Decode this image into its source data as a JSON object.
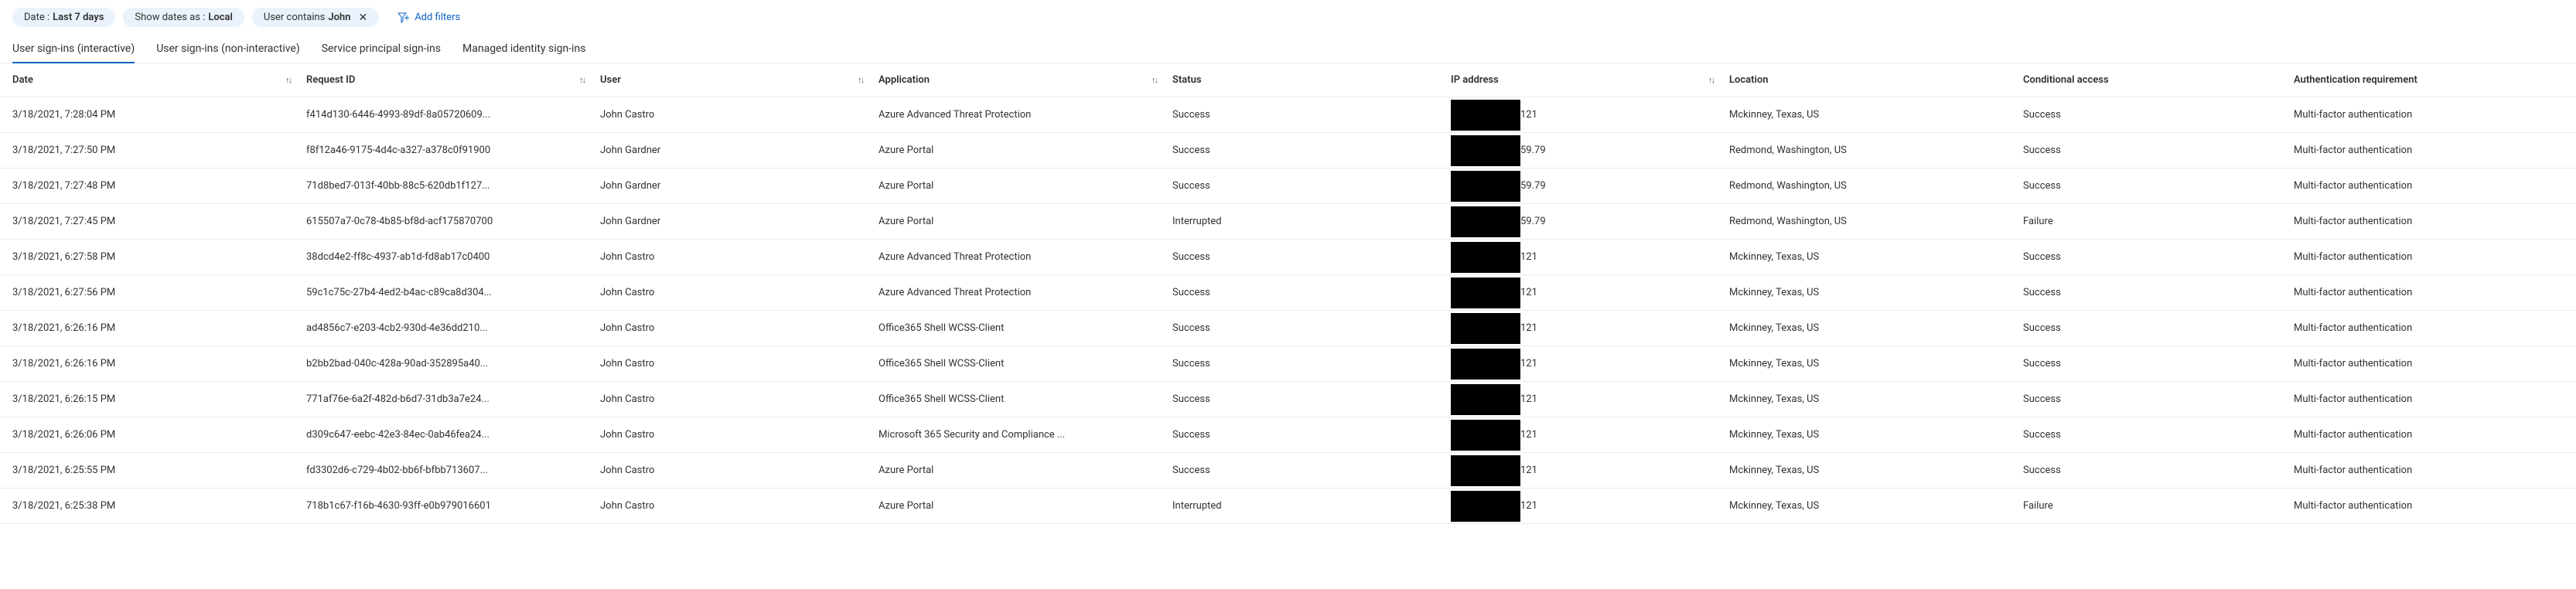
{
  "filters": {
    "date": {
      "label": "Date :",
      "value": "Last 7 days"
    },
    "showDates": {
      "label": "Show dates as :",
      "value": "Local"
    },
    "user": {
      "label": "User contains",
      "value": "John"
    },
    "addFilters": "Add filters"
  },
  "tabs": [
    {
      "label": "User sign-ins (interactive)",
      "active": true
    },
    {
      "label": "User sign-ins (non-interactive)",
      "active": false
    },
    {
      "label": "Service principal sign-ins",
      "active": false
    },
    {
      "label": "Managed identity sign-ins",
      "active": false
    }
  ],
  "columns": [
    {
      "label": "Date",
      "sortable": true
    },
    {
      "label": "Request ID",
      "sortable": true
    },
    {
      "label": "User",
      "sortable": true
    },
    {
      "label": "Application",
      "sortable": true
    },
    {
      "label": "Status",
      "sortable": false
    },
    {
      "label": "IP address",
      "sortable": true
    },
    {
      "label": "Location",
      "sortable": false
    },
    {
      "label": "Conditional access",
      "sortable": false
    },
    {
      "label": "Authentication requirement",
      "sortable": false
    }
  ],
  "rows": [
    {
      "date": "3/18/2021, 7:28:04 PM",
      "requestId": "f414d130-6446-4993-89df-8a05720609...",
      "user": "John Castro",
      "app": "Azure Advanced Threat Protection",
      "status": "Success",
      "ipSuffix": "121",
      "location": "Mckinney, Texas, US",
      "ca": "Success",
      "auth": "Multi-factor authentication"
    },
    {
      "date": "3/18/2021, 7:27:50 PM",
      "requestId": "f8f12a46-9175-4d4c-a327-a378c0f91900",
      "user": "John Gardner",
      "app": "Azure Portal",
      "status": "Success",
      "ipSuffix": "59.79",
      "location": "Redmond, Washington, US",
      "ca": "Success",
      "auth": "Multi-factor authentication"
    },
    {
      "date": "3/18/2021, 7:27:48 PM",
      "requestId": "71d8bed7-013f-40bb-88c5-620db1f127...",
      "user": "John Gardner",
      "app": "Azure Portal",
      "status": "Success",
      "ipSuffix": "59.79",
      "location": "Redmond, Washington, US",
      "ca": "Success",
      "auth": "Multi-factor authentication"
    },
    {
      "date": "3/18/2021, 7:27:45 PM",
      "requestId": "615507a7-0c78-4b85-bf8d-acf175870700",
      "user": "John Gardner",
      "app": "Azure Portal",
      "status": "Interrupted",
      "ipSuffix": "59.79",
      "location": "Redmond, Washington, US",
      "ca": "Failure",
      "auth": "Multi-factor authentication"
    },
    {
      "date": "3/18/2021, 6:27:58 PM",
      "requestId": "38dcd4e2-ff8c-4937-ab1d-fd8ab17c0400",
      "user": "John Castro",
      "app": "Azure Advanced Threat Protection",
      "status": "Success",
      "ipSuffix": "121",
      "location": "Mckinney, Texas, US",
      "ca": "Success",
      "auth": "Multi-factor authentication"
    },
    {
      "date": "3/18/2021, 6:27:56 PM",
      "requestId": "59c1c75c-27b4-4ed2-b4ac-c89ca8d304...",
      "user": "John Castro",
      "app": "Azure Advanced Threat Protection",
      "status": "Success",
      "ipSuffix": "121",
      "location": "Mckinney, Texas, US",
      "ca": "Success",
      "auth": "Multi-factor authentication"
    },
    {
      "date": "3/18/2021, 6:26:16 PM",
      "requestId": "ad4856c7-e203-4cb2-930d-4e36dd210...",
      "user": "John Castro",
      "app": "Office365 Shell WCSS-Client",
      "status": "Success",
      "ipSuffix": "121",
      "location": "Mckinney, Texas, US",
      "ca": "Success",
      "auth": "Multi-factor authentication"
    },
    {
      "date": "3/18/2021, 6:26:16 PM",
      "requestId": "b2bb2bad-040c-428a-90ad-352895a40...",
      "user": "John Castro",
      "app": "Office365 Shell WCSS-Client",
      "status": "Success",
      "ipSuffix": "121",
      "location": "Mckinney, Texas, US",
      "ca": "Success",
      "auth": "Multi-factor authentication"
    },
    {
      "date": "3/18/2021, 6:26:15 PM",
      "requestId": "771af76e-6a2f-482d-b6d7-31db3a7e24...",
      "user": "John Castro",
      "app": "Office365 Shell WCSS-Client",
      "status": "Success",
      "ipSuffix": "121",
      "location": "Mckinney, Texas, US",
      "ca": "Success",
      "auth": "Multi-factor authentication"
    },
    {
      "date": "3/18/2021, 6:26:06 PM",
      "requestId": "d309c647-eebc-42e3-84ec-0ab46fea24...",
      "user": "John Castro",
      "app": "Microsoft 365 Security and Compliance ...",
      "status": "Success",
      "ipSuffix": "121",
      "location": "Mckinney, Texas, US",
      "ca": "Success",
      "auth": "Multi-factor authentication"
    },
    {
      "date": "3/18/2021, 6:25:55 PM",
      "requestId": "fd3302d6-c729-4b02-bb6f-bfbb713607...",
      "user": "John Castro",
      "app": "Azure Portal",
      "status": "Success",
      "ipSuffix": "121",
      "location": "Mckinney, Texas, US",
      "ca": "Success",
      "auth": "Multi-factor authentication"
    },
    {
      "date": "3/18/2021, 6:25:38 PM",
      "requestId": "718b1c67-f16b-4630-93ff-e0b979016601",
      "user": "John Castro",
      "app": "Azure Portal",
      "status": "Interrupted",
      "ipSuffix": "121",
      "location": "Mckinney, Texas, US",
      "ca": "Failure",
      "auth": "Multi-factor authentication"
    }
  ]
}
